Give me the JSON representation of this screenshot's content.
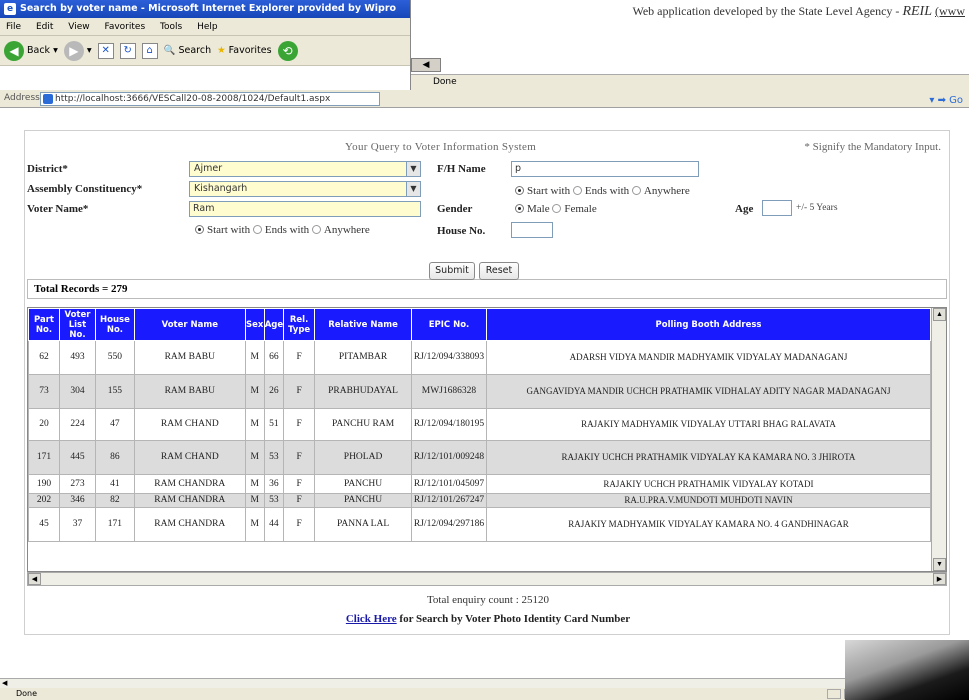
{
  "back_window": {
    "credit_prefix": "Web application developed by the State Level Agency - ",
    "credit_agency": "REIL",
    "credit_link": "(www",
    "status": "Done"
  },
  "browser": {
    "title": "Search by voter name - Microsoft Internet Explorer provided by Wipro",
    "menu": [
      "File",
      "Edit",
      "View",
      "Favorites",
      "Tools",
      "Help"
    ],
    "toolbar": {
      "back": "Back",
      "search": "Search",
      "favorites": "Favorites"
    },
    "address_label": "Address",
    "address_url": "http://localhost:3666/VESCall20-08-2008/1024/Default1.aspx"
  },
  "form": {
    "query_title": "Your Query to Voter Information System",
    "mandatory_note": "* Signify the Mandatory Input.",
    "district_label": "District*",
    "district_value": "Ajmer",
    "constituency_label": "Assembly Constituency*",
    "constituency_value": "Kishangarh",
    "voter_name_label": "Voter Name*",
    "voter_name_value": "Ram",
    "voter_match_options": [
      "Start with",
      "Ends with",
      "Anywhere"
    ],
    "fh_name_label": "F/H Name",
    "fh_name_value": "p",
    "fh_match_options": [
      "Start with",
      "Ends with",
      "Anywhere"
    ],
    "gender_label": "Gender",
    "gender_options": [
      "Male",
      "Female"
    ],
    "age_label": "Age",
    "age_value": "",
    "age_hint": "+/- 5 Years",
    "house_no_label": "House No.",
    "house_no_value": "",
    "total_records": "Total Records = 279",
    "submit_label": "Submit",
    "reset_label": "Reset"
  },
  "table": {
    "headers": [
      "Part No.",
      "Voter List No.",
      "House No.",
      "Voter Name",
      "Sex",
      "Age",
      "Rel. Type",
      "Relative Name",
      "EPIC No.",
      "Polling Booth Address"
    ],
    "rows": [
      [
        "62",
        "493",
        "550",
        "RAM BABU",
        "M",
        "66",
        "F",
        "PITAMBAR",
        "RJ/12/094/338093",
        "ADARSH VIDYA MANDIR MADHYAMIK VIDYALAY MADANAGANJ"
      ],
      [
        "73",
        "304",
        "155",
        "RAM BABU",
        "M",
        "26",
        "F",
        "PRABHUDAYAL",
        "MWJ1686328",
        "GANGAVIDYA MANDIR UCHCH PRATHAMIK VIDHALAY ADITY NAGAR MADANAGANJ"
      ],
      [
        "20",
        "224",
        "47",
        "RAM CHAND",
        "M",
        "51",
        "F",
        "PANCHU RAM",
        "RJ/12/094/180195",
        "RAJAKIY MADHYAMIK VIDYALAY UTTARI BHAG RALAVATA"
      ],
      [
        "171",
        "445",
        "86",
        "RAM CHAND",
        "M",
        "53",
        "F",
        "PHOLAD",
        "RJ/12/101/009248",
        "RAJAKIY UCHCH PRATHAMIK VIDYALAY KA KAMARA NO. 3 JHIROTA"
      ],
      [
        "190",
        "273",
        "41",
        "RAM CHANDRA",
        "M",
        "36",
        "F",
        "PANCHU",
        "RJ/12/101/045097",
        "RAJAKIY UCHCH PRATHAMIK VIDYALAY KOTADI"
      ],
      [
        "202",
        "346",
        "82",
        "RAM CHANDRA",
        "M",
        "53",
        "F",
        "PANCHU",
        "RJ/12/101/267247",
        "RA.U.PRA.V.MUNDOTI MUHDOTI NAVIN"
      ],
      [
        "45",
        "37",
        "171",
        "RAM CHANDRA",
        "M",
        "44",
        "F",
        "PANNA LAL",
        "RJ/12/094/297186",
        "RAJAKIY MADHYAMIK VIDYALAY KAMARA NO. 4 GANDHINAGAR"
      ]
    ]
  },
  "footer": {
    "enquiry_count": "Total enquiry count  :  25120",
    "click_here": "Click Here",
    "click_rest": " for Search by Voter Photo Identity Card Number"
  },
  "status": {
    "text": "Done"
  }
}
